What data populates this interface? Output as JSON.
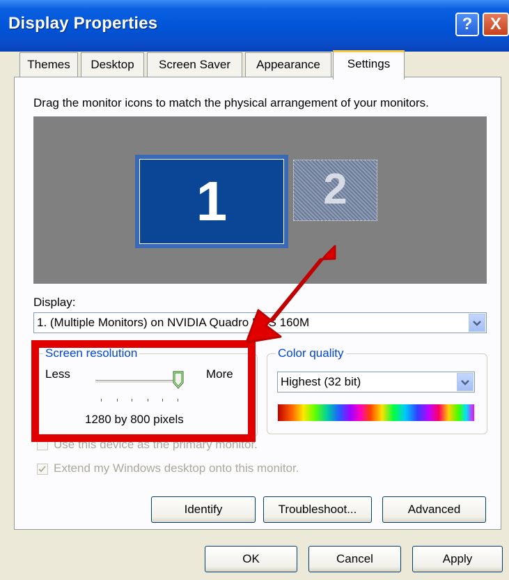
{
  "window": {
    "title": "Display Properties",
    "help_glyph": "?",
    "close_glyph": "X"
  },
  "tabs": [
    {
      "label": "Themes"
    },
    {
      "label": "Desktop"
    },
    {
      "label": "Screen Saver"
    },
    {
      "label": "Appearance"
    },
    {
      "label": "Settings",
      "selected": true
    }
  ],
  "settings": {
    "instruction": "Drag the monitor icons to match the physical arrangement of your monitors.",
    "monitors": [
      {
        "number": "1",
        "state": "primary-selected"
      },
      {
        "number": "2",
        "state": "inactive"
      }
    ],
    "display_label": "Display:",
    "display_value": "1. (Multiple Monitors) on NVIDIA Quadro NVS 160M",
    "screen_resolution": {
      "title": "Screen resolution",
      "less_label": "Less",
      "more_label": "More",
      "value_text": "1280 by 800 pixels",
      "slider_position": 1.0
    },
    "color_quality": {
      "title": "Color quality",
      "value": "Highest (32 bit)"
    },
    "checkbox_primary": {
      "label": "Use this device as the primary monitor.",
      "checked": false,
      "disabled": true
    },
    "checkbox_extend": {
      "label": "Extend my Windows desktop onto this monitor.",
      "checked": true,
      "disabled": true
    },
    "buttons": {
      "identify": "Identify",
      "troubleshoot": "Troubleshoot...",
      "advanced": "Advanced"
    }
  },
  "dialog_buttons": {
    "ok": "OK",
    "cancel": "Cancel",
    "apply": "Apply"
  },
  "annotation": {
    "color": "#e00000",
    "highlight": "screen-resolution-group"
  },
  "colors": {
    "titlebar": "#0053d6",
    "face": "#ece9d8",
    "selected_tab_accent": "#ffc83c",
    "group_title": "#0046d5"
  }
}
